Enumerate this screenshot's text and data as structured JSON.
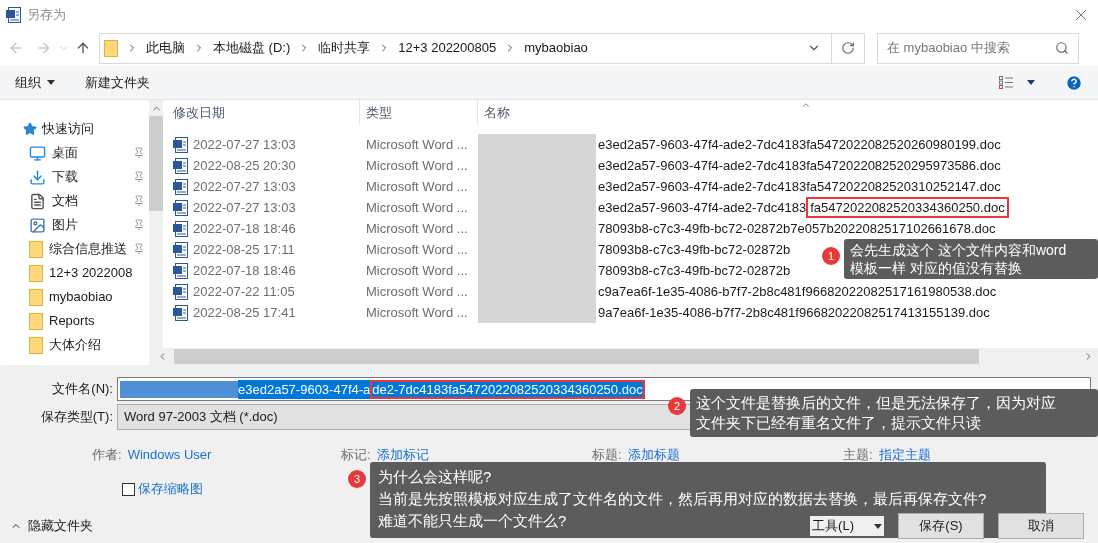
{
  "window": {
    "title": "另存为"
  },
  "address_bar": {
    "path": [
      "此电脑",
      "本地磁盘 (D:)",
      "临时共享",
      "12+3 202200805",
      "mybaobiao"
    ]
  },
  "search": {
    "placeholder": "在 mybaobiao 中搜索"
  },
  "toolbar": {
    "organize": "组织",
    "new_folder": "新建文件夹"
  },
  "sidebar": {
    "quick_access": "快速访问",
    "items": [
      {
        "label": "桌面",
        "kind": "desktop",
        "pinned": true
      },
      {
        "label": "下载",
        "kind": "download",
        "pinned": true
      },
      {
        "label": "文档",
        "kind": "document",
        "pinned": true
      },
      {
        "label": "图片",
        "kind": "picture",
        "pinned": true
      },
      {
        "label": "综合信息推送",
        "kind": "folder",
        "pinned": true
      },
      {
        "label": "12+3 2022008",
        "kind": "folder",
        "pinned": false
      },
      {
        "label": "mybaobiao",
        "kind": "folder",
        "pinned": false
      },
      {
        "label": "Reports",
        "kind": "folder",
        "pinned": false
      },
      {
        "label": "大体介绍",
        "kind": "folder",
        "pinned": false
      }
    ]
  },
  "file_list": {
    "columns": [
      "修改日期",
      "类型",
      "名称"
    ],
    "rows": [
      {
        "modified": "2022-07-27 13:03",
        "type": "Microsoft Word ...",
        "name": "e3ed2a57-9603-47f4-ade2-7dc4183fa5472022082520260980199.doc"
      },
      {
        "modified": "2022-08-25 20:30",
        "type": "Microsoft Word ...",
        "name": "e3ed2a57-9603-47f4-ade2-7dc4183fa5472022082520295973586.doc"
      },
      {
        "modified": "2022-07-27 13:03",
        "type": "Microsoft Word ...",
        "name": "e3ed2a57-9603-47f4-ade2-7dc4183fa5472022082520310252147.doc"
      },
      {
        "modified": "2022-07-27 13:03",
        "type": "Microsoft Word ...",
        "name": "e3ed2a57-9603-47f4-ade2-7dc4183",
        "name_marked": "fa5472022082520334360250.doc"
      },
      {
        "modified": "2022-07-18 18:46",
        "type": "Microsoft Word ...",
        "name": "78093b8-c7c3-49fb-bc72-02872b7e057b2022082517102661678.doc"
      },
      {
        "modified": "2022-08-25 17:11",
        "type": "Microsoft Word ...",
        "name": "78093b8-c7c3-49fb-bc72-02872b"
      },
      {
        "modified": "2022-07-18 18:46",
        "type": "Microsoft Word ...",
        "name": "78093b8-c7c3-49fb-bc72-02872b"
      },
      {
        "modified": "2022-07-22 11:05",
        "type": "Microsoft Word ...",
        "name": "c9a7ea6f-1e35-4086-b7f7-2b8c481f96682022082517161980538.doc"
      },
      {
        "modified": "2022-08-25 17:41",
        "type": "Microsoft Word ...",
        "name": "9a7ea6f-1e35-4086-b7f7-2b8c481f96682022082517413155139.doc"
      }
    ]
  },
  "form": {
    "file_name": {
      "label": "文件名(N):",
      "value": "e3ed2a57-9603-47f4-a",
      "value_marked": "de2-7dc4183fa5472022082520334360250.doc"
    },
    "save_type": {
      "label": "保存类型(T):",
      "value": "Word 97-2003 文档 (*.doc)"
    },
    "metadata": [
      {
        "label": "作者:",
        "value": "Windows User"
      },
      {
        "label": "标记:",
        "value": "添加标记"
      },
      {
        "label": "标题:",
        "value": "添加标题"
      },
      {
        "label": "主题:",
        "value": "指定主题"
      }
    ],
    "thumbnail": {
      "label": "保存缩略图",
      "checked": false
    }
  },
  "footer": {
    "hide_folders": "隐藏文件夹",
    "tools": "工具(L)",
    "save": "保存(S)",
    "cancel": "取消"
  },
  "annotations": [
    {
      "number": "1",
      "lines": [
        "会先生成这个 这个文件内容和word",
        "模板一样 对应的值没有替换"
      ]
    },
    {
      "number": "2",
      "lines": [
        "这个文件是替换后的文件，但是无法保存了，因为对应",
        "文件夹下已经有重名文件了，提示文件只读"
      ]
    },
    {
      "number": "3",
      "lines": [
        "为什么会这样呢?",
        "当前是先按照模板对应生成了文件名的文件，然后再用对应的数据去替换，最后再保存文件?",
        "难道不能只生成一个文件么?"
      ]
    }
  ]
}
